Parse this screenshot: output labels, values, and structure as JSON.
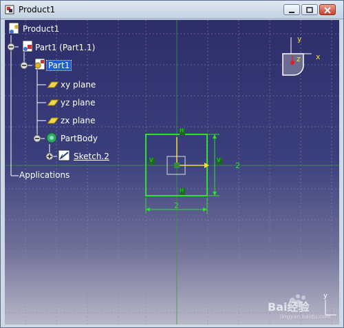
{
  "window": {
    "title": "Product1",
    "icons": {
      "app": "catia-window-icon",
      "minimize": "minimize-icon",
      "maximize": "maximize-icon",
      "close": "close-icon"
    }
  },
  "tree": {
    "items": [
      {
        "label": "Product1",
        "icon": "product-icon"
      },
      {
        "label": "Part1 (Part1.1)",
        "icon": "part-instance-icon"
      },
      {
        "label": "Part1",
        "icon": "part-icon",
        "selected": true
      },
      {
        "label": "xy plane",
        "icon": "plane-icon"
      },
      {
        "label": "yz plane",
        "icon": "plane-icon"
      },
      {
        "label": "zx plane",
        "icon": "plane-icon"
      },
      {
        "label": "PartBody",
        "icon": "body-gear-icon"
      },
      {
        "label": "Sketch.2",
        "icon": "sketch-icon"
      },
      {
        "label": "Applications",
        "icon": ""
      }
    ]
  },
  "compass": {
    "x_label": "x",
    "y_label": "y",
    "z_label": "z"
  },
  "sketch": {
    "dimension_horizontal": "2",
    "dimension_vertical": "2",
    "constraint_label": "H",
    "axis_label": "V"
  },
  "axis_corner": {
    "y_label": "y"
  },
  "watermark": {
    "logo_text": "Bai经验",
    "url": "jingyan.baidu.com"
  },
  "colors": {
    "sketch_green": "#2fe02f",
    "selected_blue": "#1e5fd6",
    "axis_yellow": "#f2e236"
  }
}
